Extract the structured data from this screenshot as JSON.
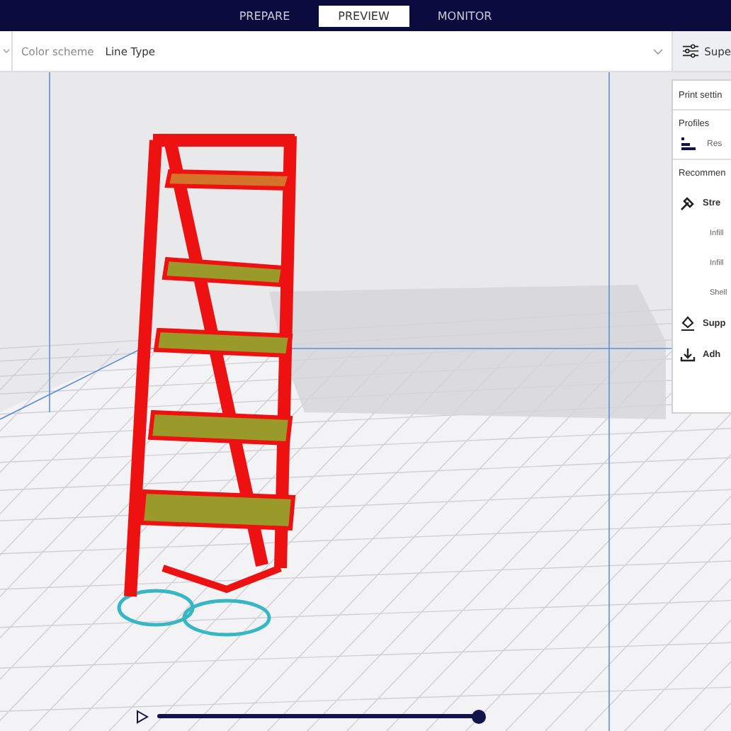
{
  "stages": [
    {
      "label": "PREPARE",
      "selected": false
    },
    {
      "label": "PREVIEW",
      "selected": true
    },
    {
      "label": "MONITOR",
      "selected": false
    }
  ],
  "view_bar": {
    "label": "Color scheme",
    "value": "Line Type"
  },
  "settings_button": {
    "label": "Supe"
  },
  "print_settings": {
    "title": "Print settin",
    "profiles_label": "Profiles",
    "profile": "Res",
    "recommended_label": "Recommen",
    "sections": [
      {
        "kind": "strength",
        "label": "Stre"
      },
      {
        "kind": "setting",
        "label": "Infill"
      },
      {
        "kind": "setting",
        "label": "Infill"
      },
      {
        "kind": "setting",
        "label": "Shell"
      },
      {
        "kind": "support",
        "label": "Supp"
      },
      {
        "kind": "adhesion",
        "label": "Adh"
      }
    ]
  },
  "layer_slider": {
    "level": 1
  }
}
